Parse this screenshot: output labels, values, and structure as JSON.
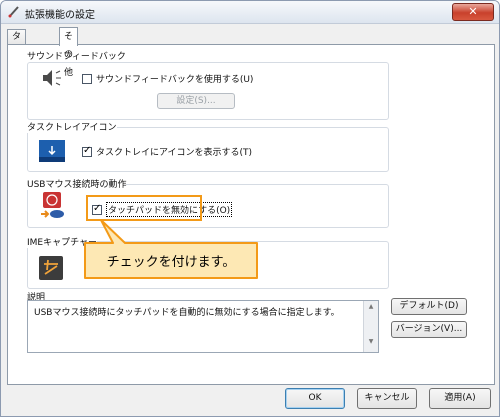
{
  "window": {
    "title": "拡張機能の設定",
    "close_label": "✕"
  },
  "tabs": [
    {
      "label": "タッチパッド"
    },
    {
      "label": "その他"
    }
  ],
  "groups": {
    "sound": {
      "title": "サウンドフィードバック",
      "checkbox_label": "サウンドフィードバックを使用する(U)",
      "checkbox_checked": false,
      "settings_button": "設定(S)..."
    },
    "tray": {
      "title": "タスクトレイアイコン",
      "checkbox_label": "タスクトレイにアイコンを表示する(T)",
      "checkbox_checked": true
    },
    "usb": {
      "title": "USBマウス接続時の動作",
      "checkbox_label": "タッチパッドを無効にする(O)",
      "checkbox_checked": true
    },
    "ime": {
      "title": "IMEキャプチャー"
    }
  },
  "callout": {
    "text": "チェックを付けます。"
  },
  "description": {
    "title": "説明",
    "text": "USBマウス接続時にタッチパッドを自動的に無効にする場合に指定します。"
  },
  "side_buttons": {
    "default": "デフォルト(D)",
    "version": "バージョン(V)..."
  },
  "footer": {
    "ok": "OK",
    "cancel": "キャンセル",
    "apply": "適用(A)"
  }
}
